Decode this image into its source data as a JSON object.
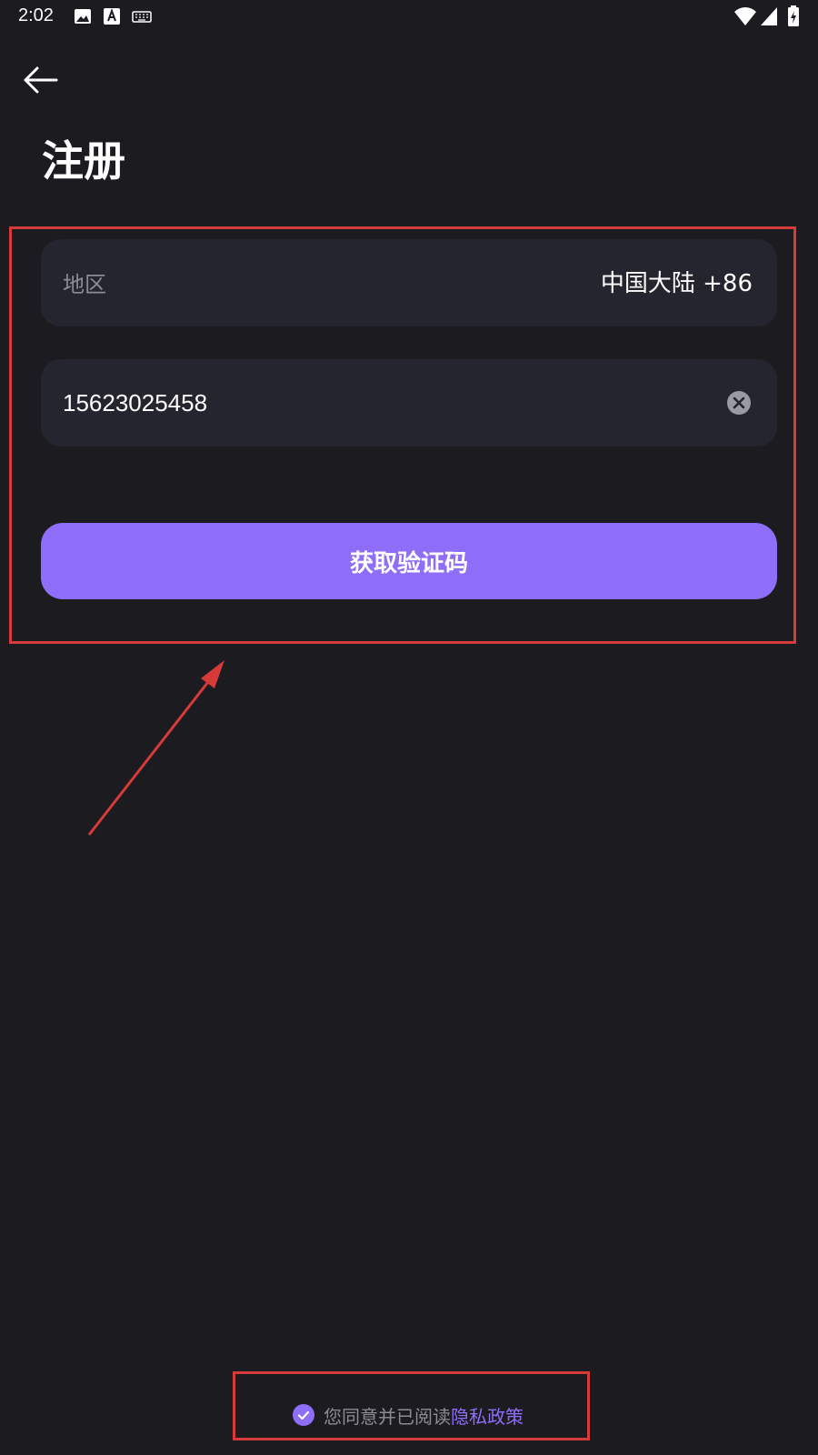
{
  "status_bar": {
    "time": "2:02",
    "icons": [
      "image-icon",
      "a-icon",
      "keyboard-icon",
      "wifi-icon",
      "signal-icon",
      "battery-icon"
    ]
  },
  "header": {
    "back_icon": "arrow-left-icon",
    "title": "注册"
  },
  "form": {
    "region": {
      "label": "地区",
      "value": "中国大陆 +86"
    },
    "phone": {
      "value": "15623025458",
      "clear_icon": "close-circle-icon"
    },
    "submit_label": "获取验证码"
  },
  "agreement": {
    "checked": true,
    "text": "您同意并已阅读",
    "link_label": "隐私政策"
  },
  "colors": {
    "background": "#1b1b20",
    "field": "#25252f",
    "accent": "#8e6ef8",
    "annotation": "#d63a3a"
  }
}
